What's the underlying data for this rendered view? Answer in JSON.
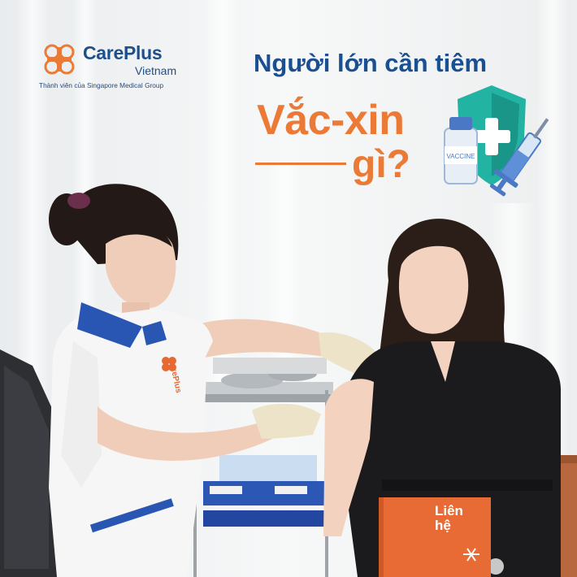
{
  "brand": {
    "name": "CarePlus",
    "sub": "Vietnam",
    "tagline": "Thành viên của Singapore Medical Group"
  },
  "headline": {
    "line1": "Người lớn cần tiêm",
    "line2": "Vắc-xin",
    "line3": "gì?"
  },
  "graphic": {
    "vial_label": "VACCINE",
    "icon": "shield-plus-icon"
  },
  "photo": {
    "badge": "CarePlus",
    "booklet_title_1": "Liên",
    "booklet_title_2": "hệ"
  },
  "colors": {
    "brand_blue": "#1a4f91",
    "accent_orange": "#ec7a37",
    "shield_teal": "#1fa79a"
  }
}
